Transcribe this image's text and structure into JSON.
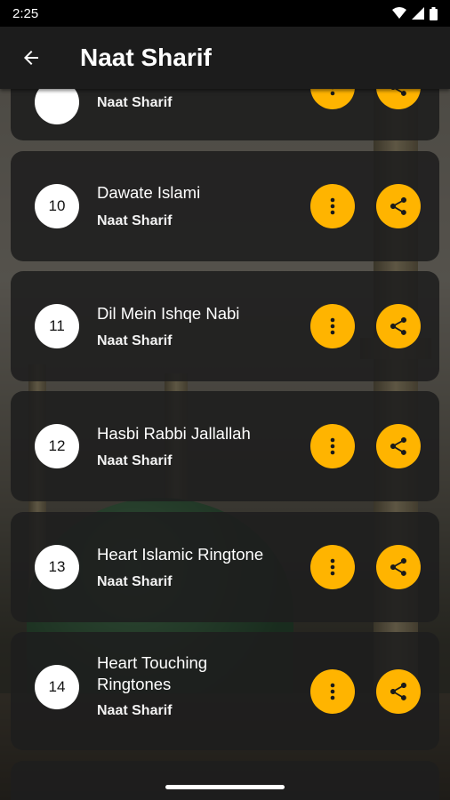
{
  "status_bar": {
    "time": "2:25"
  },
  "app_bar": {
    "title": "Naat Sharif",
    "back_icon": "arrow-back-icon"
  },
  "colors": {
    "accent": "#ffb400",
    "card": "#1e1e1e",
    "app_bar": "#1c1c1c"
  },
  "list": {
    "items": [
      {
        "number": "",
        "title": "",
        "subtitle": "Naat Sharif"
      },
      {
        "number": "10",
        "title": "Dawate Islami",
        "subtitle": "Naat Sharif"
      },
      {
        "number": "11",
        "title": "Dil Mein Ishqe Nabi",
        "subtitle": "Naat Sharif"
      },
      {
        "number": "12",
        "title": "Hasbi Rabbi Jallallah",
        "subtitle": "Naat Sharif"
      },
      {
        "number": "13",
        "title": "Heart Islamic Ringtone",
        "subtitle": "Naat Sharif"
      },
      {
        "number": "14",
        "title": "Heart Touching Ringtones",
        "subtitle": "Naat Sharif"
      }
    ],
    "more_icon": "more-vert-icon",
    "share_icon": "share-icon"
  }
}
